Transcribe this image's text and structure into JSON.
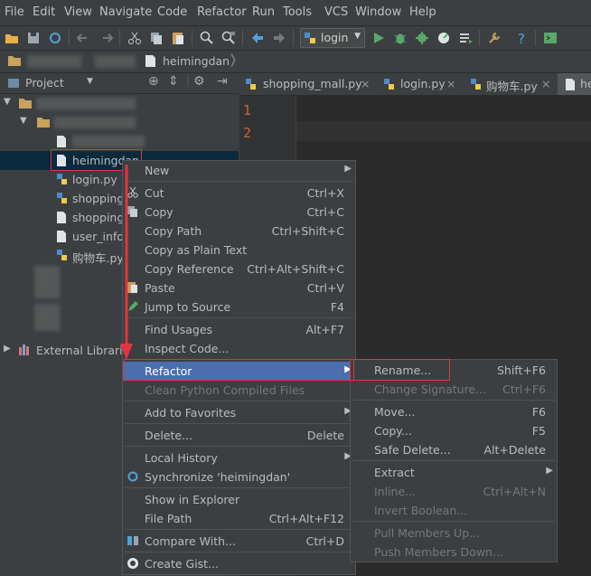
{
  "menubar": {
    "items": [
      "File",
      "Edit",
      "View",
      "Navigate",
      "Code",
      "Refactor",
      "Run",
      "Tools",
      "VCS",
      "Window",
      "Help"
    ]
  },
  "toolbar": {
    "run_config": "login"
  },
  "navbar": {
    "crumb": "heimingdan"
  },
  "project_panel": {
    "title": "Project"
  },
  "tree": {
    "selected": "heimingdan",
    "files": [
      "login.py",
      "shopping",
      "shopping",
      "user_infor",
      "购物车.py"
    ],
    "external": "External Librarie"
  },
  "tabs": [
    "shopping_mall.py",
    "login.py",
    "购物车.py",
    "he"
  ],
  "editor": {
    "lines": [
      "1",
      "2"
    ]
  },
  "context_menu": {
    "items": [
      {
        "label": "New",
        "shortcut": "",
        "submenu": true
      },
      {
        "label": "Cut",
        "shortcut": "Ctrl+X"
      },
      {
        "label": "Copy",
        "shortcut": "Ctrl+C"
      },
      {
        "label": "Copy Path",
        "shortcut": "Ctrl+Shift+C"
      },
      {
        "label": "Copy as Plain Text",
        "shortcut": ""
      },
      {
        "label": "Copy Reference",
        "shortcut": "Ctrl+Alt+Shift+C"
      },
      {
        "label": "Paste",
        "shortcut": "Ctrl+V"
      },
      {
        "label": "Jump to Source",
        "shortcut": "F4"
      },
      {
        "label": "Find Usages",
        "shortcut": "Alt+F7"
      },
      {
        "label": "Inspect Code...",
        "shortcut": ""
      },
      {
        "label": "Refactor",
        "shortcut": "",
        "submenu": true
      },
      {
        "label": "Clean Python Compiled Files",
        "shortcut": ""
      },
      {
        "label": "Add to Favorites",
        "shortcut": "",
        "submenu": true
      },
      {
        "label": "Delete...",
        "shortcut": "Delete"
      },
      {
        "label": "Local History",
        "shortcut": "",
        "submenu": true
      },
      {
        "label": "Synchronize 'heimingdan'",
        "shortcut": ""
      },
      {
        "label": "Show in Explorer",
        "shortcut": ""
      },
      {
        "label": "File Path",
        "shortcut": "Ctrl+Alt+F12"
      },
      {
        "label": "Compare With...",
        "shortcut": "Ctrl+D"
      },
      {
        "label": "Create Gist...",
        "shortcut": ""
      }
    ]
  },
  "refactor_menu": {
    "items": [
      {
        "label": "Rename...",
        "shortcut": "Shift+F6"
      },
      {
        "label": "Change Signature...",
        "shortcut": "Ctrl+F6"
      },
      {
        "label": "Move...",
        "shortcut": "F6"
      },
      {
        "label": "Copy...",
        "shortcut": "F5"
      },
      {
        "label": "Safe Delete...",
        "shortcut": "Alt+Delete"
      },
      {
        "label": "Extract",
        "shortcut": ""
      },
      {
        "label": "Inline...",
        "shortcut": "Ctrl+Alt+N"
      },
      {
        "label": "Invert Boolean...",
        "shortcut": ""
      },
      {
        "label": "Pull Members Up...",
        "shortcut": ""
      },
      {
        "label": "Push Members Down...",
        "shortcut": ""
      }
    ]
  },
  "colors": {
    "accent": "#4b6eaf",
    "annotation": "#e0353f",
    "line_number": "#cc6633"
  }
}
